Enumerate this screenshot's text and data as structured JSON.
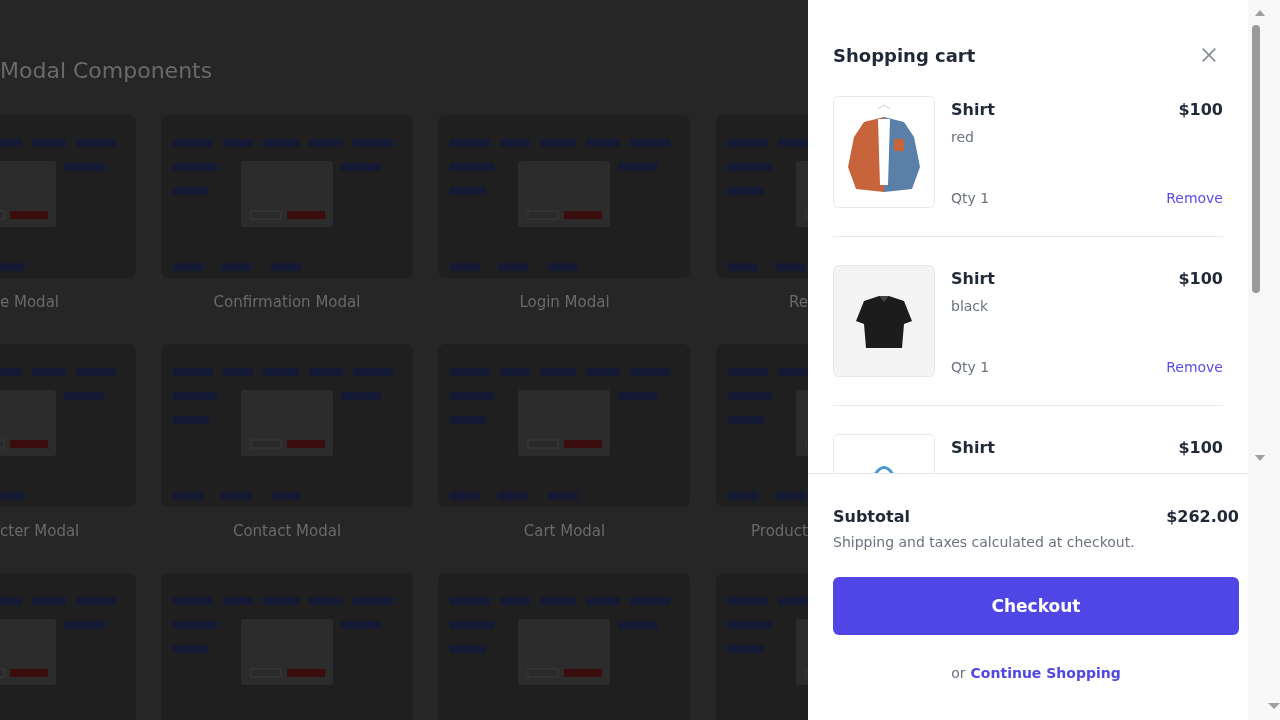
{
  "page": {
    "title": "Modal Components",
    "cards": [
      {
        "label": "e Modal",
        "kind": "preview"
      },
      {
        "label": "Confirmation Modal",
        "kind": "preview"
      },
      {
        "label": "Login Modal",
        "kind": "preview"
      },
      {
        "label": "Re",
        "kind": "preview"
      },
      {
        "label": "cter Modal",
        "kind": "preview"
      },
      {
        "label": "Contact Modal",
        "kind": "preview"
      },
      {
        "label": "Cart Modal",
        "kind": "preview"
      },
      {
        "label": "Product",
        "kind": "preview"
      },
      {
        "kind": "preview"
      },
      {
        "kind": "preview"
      },
      {
        "kind": "preview"
      },
      {
        "kind": "preview"
      }
    ]
  },
  "cart": {
    "title": "Shopping cart",
    "items": [
      {
        "name": "Shirt",
        "price": "$100",
        "variant": "red",
        "qty": "Qty 1",
        "remove": "Remove",
        "kind": "picture"
      },
      {
        "name": "Shirt",
        "price": "$100",
        "variant": "black",
        "qty": "Qty 1",
        "remove": "Remove",
        "kind": "picture"
      },
      {
        "name": "Shirt",
        "price": "$100",
        "kind": "picture"
      }
    ],
    "subtotal_label": "Subtotal",
    "subtotal": "$262.00",
    "note": "Shipping and taxes calculated at checkout.",
    "checkout": "Checkout",
    "or": "or",
    "continue": "Continue Shopping"
  }
}
